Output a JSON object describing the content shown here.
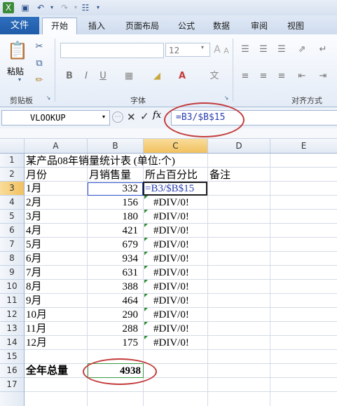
{
  "tabs": {
    "file": "文件",
    "items": [
      "开始",
      "插入",
      "页面布局",
      "公式",
      "数据",
      "审阅",
      "视图"
    ],
    "active": "开始"
  },
  "ribbon": {
    "paste_label": "粘贴",
    "clipboard_label": "剪贴板",
    "font_label": "字体",
    "align_label": "对齐方式",
    "font_size": "12",
    "bold": "B",
    "italic": "I",
    "underline": "U",
    "grow_font": "A",
    "shrink_font": "A",
    "font_color": "A"
  },
  "formula_bar": {
    "name_box": "VLOOKUP",
    "fx": "fx",
    "formula": "=B3/$B$15"
  },
  "columns": [
    "A",
    "B",
    "C",
    "D",
    "E"
  ],
  "rows": [
    "1",
    "2",
    "3",
    "4",
    "5",
    "6",
    "7",
    "8",
    "9",
    "10",
    "11",
    "12",
    "13",
    "14",
    "15",
    "16",
    "17"
  ],
  "sheet": {
    "title": "某产品08年销量统计表 (单位:个)",
    "headers": [
      "月份",
      "月销售量",
      "所占百分比",
      "备注"
    ],
    "months": [
      "1月",
      "2月",
      "3月",
      "4月",
      "5月",
      "6月",
      "7月",
      "8月",
      "9月",
      "10月",
      "11月",
      "12月"
    ],
    "sales": [
      "332",
      "156",
      "180",
      "421",
      "679",
      "934",
      "631",
      "388",
      "464",
      "290",
      "288",
      "175"
    ],
    "c3": "=B3/$B$15",
    "errors": [
      "#DIV/0!",
      "#DIV/0!",
      "#DIV/0!",
      "#DIV/0!",
      "#DIV/0!",
      "#DIV/0!",
      "#DIV/0!",
      "#DIV/0!",
      "#DIV/0!",
      "#DIV/0!",
      "#DIV/0!"
    ],
    "total_label": "全年总量",
    "total_value": "4938"
  },
  "colors": {
    "file_tab": "#1f5ba8",
    "annotation": "#c33b3b",
    "selected_header": "#f1c15f",
    "error_indicator": "#2e8b3a"
  }
}
